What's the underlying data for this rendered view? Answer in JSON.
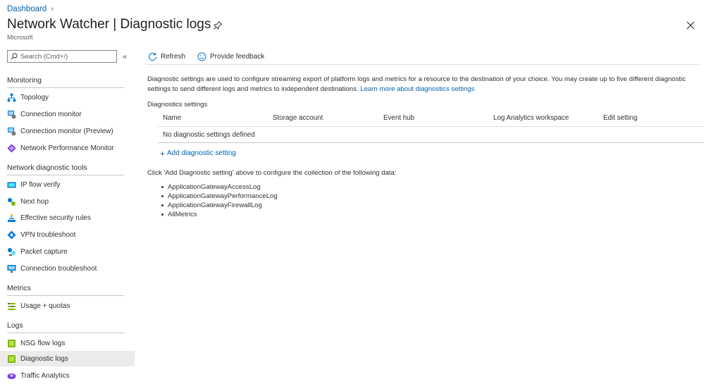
{
  "header": {
    "breadcrumb": "Dashboard",
    "title_main": "Network Watcher",
    "title_sep": " | ",
    "title_sub": "Diagnostic logs",
    "subtitle": "Microsoft"
  },
  "sidebar": {
    "search_placeholder": "Search (Cmd+/)",
    "sections": [
      {
        "label": "Monitoring"
      },
      {
        "label": "Network diagnostic tools"
      },
      {
        "label": "Metrics"
      },
      {
        "label": "Logs"
      }
    ],
    "items": [
      {
        "label": "Topology"
      },
      {
        "label": "Connection monitor"
      },
      {
        "label": "Connection monitor (Preview)"
      },
      {
        "label": "Network Performance Monitor"
      },
      {
        "label": "IP flow verify"
      },
      {
        "label": "Next hop"
      },
      {
        "label": "Effective security rules"
      },
      {
        "label": "VPN troubleshoot"
      },
      {
        "label": "Packet capture"
      },
      {
        "label": "Connection troubleshoot"
      },
      {
        "label": "Usage + quotas"
      },
      {
        "label": "NSG flow logs"
      },
      {
        "label": "Diagnostic logs",
        "selected": true
      },
      {
        "label": "Traffic Analytics"
      }
    ]
  },
  "toolbar": {
    "refresh": "Refresh",
    "feedback": "Provide feedback"
  },
  "main": {
    "description": "Diagnostic settings are used to configure streaming export of platform logs and metrics for a resource to the destination of your choice. You may create up to five different diagnostic settings to send different logs and metrics to independent destinations.",
    "learn_more": "Learn more about diagnostics settings",
    "section_label": "Diagnostics settings",
    "columns": [
      "Name",
      "Storage account",
      "Event hub",
      "Log Analytics workspace",
      "Edit setting"
    ],
    "empty_row": "No diagnostic settings defined",
    "add_setting": "Add diagnostic setting",
    "click_info": "Click 'Add Diagnostic setting' above to configure the collection of the following data:",
    "data_items": [
      "ApplicationGatewayAccessLog",
      "ApplicationGatewayPerformanceLog",
      "ApplicationGatewayFirewallLog",
      "AllMetrics"
    ]
  },
  "colors": {
    "link": "#0063b1",
    "selected_bg": "#edebe9",
    "text": "#323130"
  }
}
